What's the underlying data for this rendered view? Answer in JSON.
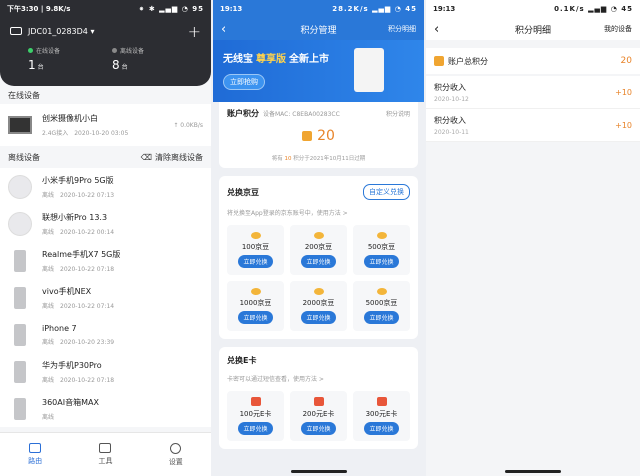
{
  "phone1": {
    "status": {
      "time": "下午3:30 | 9.8K/s",
      "icons": "⁕ ✱ ▂▄▆ ◔ 95"
    },
    "router": {
      "name": "JDC01_0283D4 ▾",
      "add_icon": "+"
    },
    "stats": {
      "online_label": "在线设备",
      "online_count": "1",
      "online_unit": "台",
      "offline_label": "离线设备",
      "offline_count": "8",
      "offline_unit": "台",
      "online_color": "#3ccf6a",
      "offline_color": "#8a8a8a"
    },
    "online_section": "在线设备",
    "online_device": {
      "name": "创米摄像机小白",
      "band": "2.4G接入",
      "time": "2020-10-20 03:05",
      "speed": "↑ 0.0KB/s"
    },
    "offline_section": "离线设备",
    "clear_label": "清除离线设备",
    "offline_devices": [
      {
        "name": "小米手机9Pro 5G版",
        "status": "离线",
        "time": "2020-10-22 07:13",
        "icon": "round"
      },
      {
        "name": "联想小新Pro 13.3",
        "status": "离线",
        "time": "2020-10-22 00:14",
        "icon": "round"
      },
      {
        "name": "Realme手机X7 5G版",
        "status": "离线",
        "time": "2020-10-22 07:18",
        "icon": "phone"
      },
      {
        "name": "vivo手机NEX",
        "status": "离线",
        "time": "2020-10-22 07:14",
        "icon": "phone"
      },
      {
        "name": "iPhone 7",
        "status": "离线",
        "time": "2020-10-20 23:39",
        "icon": "phone"
      },
      {
        "name": "华为手机P30Pro",
        "status": "离线",
        "time": "2020-10-22 07:18",
        "icon": "phone"
      },
      {
        "name": "360AI音箱MAX",
        "status": "离线",
        "time": "",
        "icon": "phone"
      }
    ],
    "tabs": [
      {
        "label": "路由",
        "active": true
      },
      {
        "label": "工具",
        "active": false
      },
      {
        "label": "设置",
        "active": false
      }
    ]
  },
  "phone2": {
    "status": {
      "time": "19:13",
      "icons": "28.2K/s ▂▄▆ ◔ 45"
    },
    "title": "积分管理",
    "right": "积分明细",
    "banner": {
      "part1": "无线宝",
      "highlight": "尊享版",
      "part2": "全新上市",
      "buy": "立即抢购"
    },
    "points": {
      "title": "账户积分",
      "mac": "设备MAC: C8EBA00283CC",
      "rules": "积分说明",
      "value": "20",
      "note_pre": "将有",
      "note_num": "10",
      "note_post": "积分于2021年10月11日过期"
    },
    "jd": {
      "title": "兑换京豆",
      "custom": "自定义兑换",
      "sub": "将兑换至App登录的京东账号中，使用方法 >",
      "items": [
        {
          "label": "100京豆",
          "btn": "立即兑换"
        },
        {
          "label": "200京豆",
          "btn": "立即兑换"
        },
        {
          "label": "500京豆",
          "btn": "立即兑换"
        },
        {
          "label": "1000京豆",
          "btn": "立即兑换"
        },
        {
          "label": "2000京豆",
          "btn": "立即兑换"
        },
        {
          "label": "5000京豆",
          "btn": "立即兑换"
        }
      ]
    },
    "ecard": {
      "title": "兑换E卡",
      "sub": "卡密可以通过短信查看，使用方法 >",
      "items": [
        {
          "label": "100元E卡",
          "btn": "立即兑换"
        },
        {
          "label": "200元E卡",
          "btn": "立即兑换"
        },
        {
          "label": "300元E卡",
          "btn": "立即兑换"
        }
      ]
    }
  },
  "phone3": {
    "status": {
      "time": "19:13",
      "icons": "0.1K/s ▂▄▆ ◔ 45"
    },
    "title": "积分明细",
    "right": "我的设备",
    "total_label": "账户总积分",
    "total_value": "20",
    "records": [
      {
        "name": "积分收入",
        "date": "2020-10-12",
        "amount": "+10"
      },
      {
        "name": "积分收入",
        "date": "2020-10-11",
        "amount": "+10"
      }
    ]
  }
}
